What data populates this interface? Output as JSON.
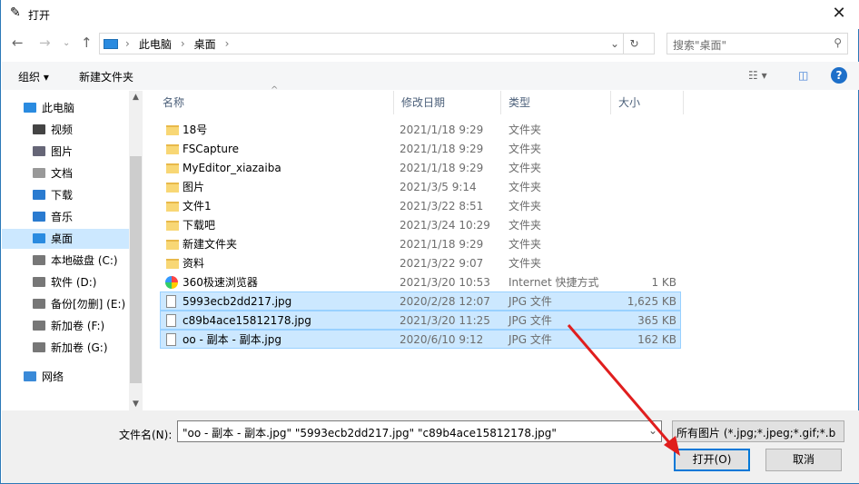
{
  "title": "打开",
  "address": {
    "crumbs": [
      "此电脑",
      "桌面"
    ]
  },
  "search": {
    "placeholder": "搜索\"桌面\""
  },
  "toolbar": {
    "organize": "组织 ▾",
    "new_folder": "新建文件夹",
    "help": "?"
  },
  "sidebar": {
    "items": [
      {
        "label": "此电脑",
        "icon": "pc-icon"
      },
      {
        "label": "视频",
        "icon": "video-icon"
      },
      {
        "label": "图片",
        "icon": "picture-icon"
      },
      {
        "label": "文档",
        "icon": "document-icon"
      },
      {
        "label": "下载",
        "icon": "download-icon"
      },
      {
        "label": "音乐",
        "icon": "music-icon"
      },
      {
        "label": "桌面",
        "icon": "desktop-icon",
        "selected": true
      },
      {
        "label": "本地磁盘 (C:)",
        "icon": "drive-icon"
      },
      {
        "label": "软件 (D:)",
        "icon": "drive-icon"
      },
      {
        "label": "备份[勿删] (E:)",
        "icon": "drive-icon"
      },
      {
        "label": "新加卷 (F:)",
        "icon": "drive-icon"
      },
      {
        "label": "新加卷 (G:)",
        "icon": "drive-icon"
      },
      {
        "label": "网络",
        "icon": "network-icon"
      }
    ]
  },
  "columns": [
    "名称",
    "修改日期",
    "类型",
    "大小"
  ],
  "files": [
    {
      "name": "18号",
      "date": "2021/1/18 9:29",
      "type": "文件夹",
      "size": "",
      "kind": "folder"
    },
    {
      "name": "FSCapture",
      "date": "2021/1/18 9:29",
      "type": "文件夹",
      "size": "",
      "kind": "folder"
    },
    {
      "name": "MyEditor_xiazaiba",
      "date": "2021/1/18 9:29",
      "type": "文件夹",
      "size": "",
      "kind": "folder"
    },
    {
      "name": "图片",
      "date": "2021/3/5 9:14",
      "type": "文件夹",
      "size": "",
      "kind": "folder"
    },
    {
      "name": "文件1",
      "date": "2021/3/22 8:51",
      "type": "文件夹",
      "size": "",
      "kind": "folder"
    },
    {
      "name": "下载吧",
      "date": "2021/3/24 10:29",
      "type": "文件夹",
      "size": "",
      "kind": "folder"
    },
    {
      "name": "新建文件夹",
      "date": "2021/1/18 9:29",
      "type": "文件夹",
      "size": "",
      "kind": "folder"
    },
    {
      "name": "资料",
      "date": "2021/3/22 9:07",
      "type": "文件夹",
      "size": "",
      "kind": "folder"
    },
    {
      "name": "360极速浏览器",
      "date": "2021/3/20 10:53",
      "type": "Internet 快捷方式",
      "size": "1 KB",
      "kind": "web"
    },
    {
      "name": "5993ecb2dd217.jpg",
      "date": "2020/2/28 12:07",
      "type": "JPG 文件",
      "size": "1,625 KB",
      "kind": "img",
      "selected": true
    },
    {
      "name": "c89b4ace15812178.jpg",
      "date": "2021/3/20 11:25",
      "type": "JPG 文件",
      "size": "365 KB",
      "kind": "img",
      "selected": true
    },
    {
      "name": "oo - 副本 - 副本.jpg",
      "date": "2020/6/10 9:12",
      "type": "JPG 文件",
      "size": "162 KB",
      "kind": "img",
      "selected": true
    }
  ],
  "filename": {
    "label": "文件名(N):",
    "value": "\"oo - 副本 - 副本.jpg\" \"5993ecb2dd217.jpg\" \"c89b4ace15812178.jpg\""
  },
  "filetype": {
    "value": "所有图片 (*.jpg;*.jpeg;*.gif;*.b"
  },
  "buttons": {
    "open": "打开(O)",
    "cancel": "取消"
  }
}
